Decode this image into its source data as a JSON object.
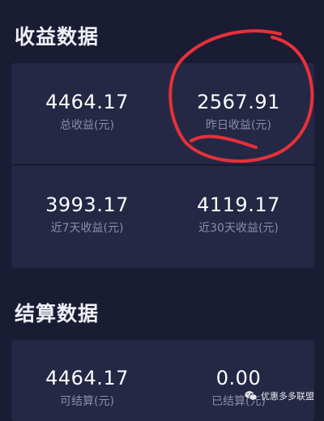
{
  "earnings": {
    "title": "收益数据",
    "total": {
      "value": "4464.17",
      "label": "总收益(元)"
    },
    "yesterday": {
      "value": "2567.91",
      "label": "昨日收益(元)"
    },
    "last7": {
      "value": "3993.17",
      "label": "近7天收益(元)"
    },
    "last30": {
      "value": "4119.17",
      "label": "近30天收益(元)"
    }
  },
  "settlement": {
    "title": "结算数据",
    "settleable": {
      "value": "4464.17",
      "label": "可结算(元)"
    },
    "settled": {
      "value": "0.00",
      "label": "已结算(元)"
    }
  },
  "watermark": {
    "text": "优惠多多联盟",
    "icon": "wechat-icon"
  },
  "colors": {
    "background": "#1a1c33",
    "card": "#252844",
    "label": "#8a8da8",
    "annotation": "#e8303a"
  }
}
